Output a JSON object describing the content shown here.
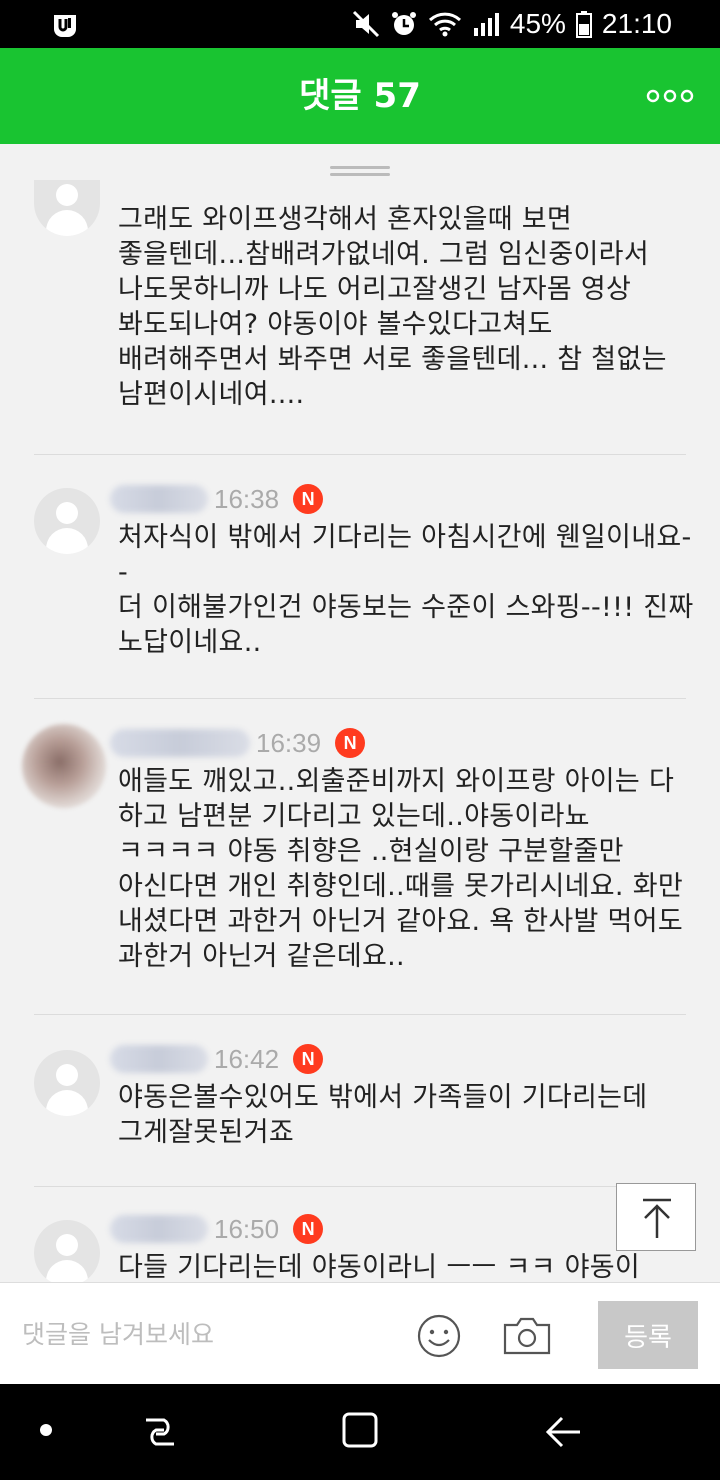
{
  "status_bar": {
    "battery": "45%",
    "time": "21:10",
    "icons": [
      "app-logo-icon",
      "mute-icon",
      "alarm-icon",
      "wifi-icon",
      "signal-icon",
      "battery-icon"
    ]
  },
  "header": {
    "title": "댓글 57",
    "more_icon": "more-icon"
  },
  "comments": [
    {
      "time": "",
      "text_lines": [
        "그래도 와이프생각해서 혼자있을때 보면",
        "좋을텐데...참배려가없네여. 그럼 임신중이라서",
        "나도못하니까 나도 어리고잘생긴 남자몸 영상",
        "봐도되나여? 야동이야 볼수있다고쳐도",
        "배려해주면서 봐주면 서로 좋을텐데... 참 철없는",
        "남편이시네여...."
      ]
    },
    {
      "time": "16:38",
      "badge": "N",
      "text_lines": [
        "처자식이 밖에서 기다리는 아침시간에 웬일이내요-",
        "-",
        "더 이해불가인건 야동보는 수준이 스와핑--!!! 진짜",
        "노답이네요.."
      ]
    },
    {
      "time": "16:39",
      "badge": "N",
      "text_lines": [
        "애들도 깨있고..외출준비까지 와이프랑 아이는 다",
        "하고 남편분 기다리고 있는데..야동이라뇨",
        "ㅋㅋㅋㅋ 야동 취향은 ..현실이랑 구분할줄만",
        "아신다면 개인 취향인데..때를 못가리시네요. 화만",
        "내셨다면 과한거 아닌거 같아요. 욕 한사발 먹어도",
        "과한거 아닌거 같은데요.."
      ]
    },
    {
      "time": "16:42",
      "badge": "N",
      "text_lines": [
        "야동은볼수있어도 밖에서 가족들이 기다리는데",
        "그게잘못된거죠"
      ]
    },
    {
      "time": "16:50",
      "badge": "N",
      "text_lines": [
        "다들 기다리는데 야동이라니 ㅡㅡ ㅋㅋ 야동이"
      ]
    }
  ],
  "input_bar": {
    "placeholder": "댓글을 남겨보세요",
    "submit_label": "등록"
  },
  "colors": {
    "header_green": "#19c431",
    "badge_red": "#ff3b1f",
    "submit_disabled": "#c8c8c8"
  }
}
